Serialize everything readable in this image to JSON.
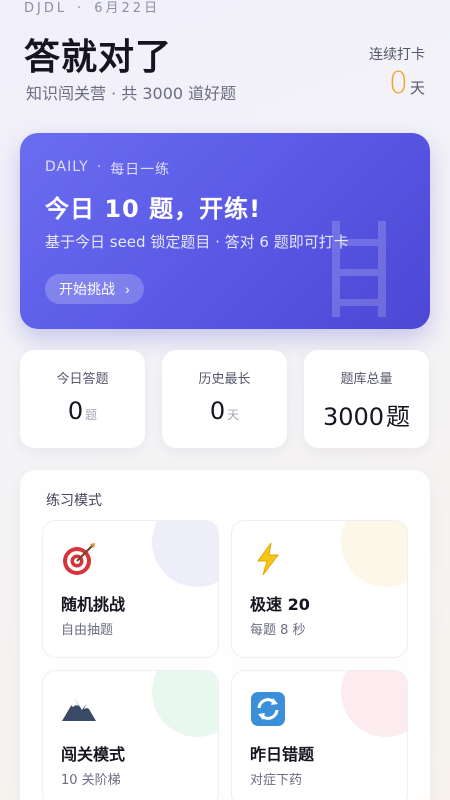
{
  "header": {
    "brand": "DJDL",
    "dot": "·",
    "date": "6月22日",
    "title": "答就对了",
    "subtitle": "知识闯关营 · 共 3000 道好题",
    "streak_label": "连续打卡",
    "streak_value": "0",
    "streak_unit": "天"
  },
  "daily": {
    "kicker_en": "DAILY",
    "kicker_sep": "·",
    "kicker_cn": "每日一练",
    "title": "今日 10 题，开练!",
    "desc": "基于今日 seed 锁定题目 · 答对 6 题即可打卡",
    "button": "开始挑战",
    "button_chevron": "›"
  },
  "stats": [
    {
      "label": "今日答题",
      "value": "0",
      "unit": "题"
    },
    {
      "label": "历史最长",
      "value": "0",
      "unit": "天"
    },
    {
      "label": "题库总量",
      "value": "3000",
      "unit": "题"
    }
  ],
  "practice": {
    "title": "练习模式",
    "modes": [
      {
        "name": "随机挑战",
        "desc": "自由抽题",
        "icon": "target-icon",
        "blob": "#eeeefb"
      },
      {
        "name": "极速 20",
        "desc": "每题 8 秒",
        "icon": "lightning-icon",
        "blob": "#fdf7e9"
      },
      {
        "name": "闯关模式",
        "desc": "10 关阶梯",
        "icon": "mountain-icon",
        "blob": "#e9f8ef"
      },
      {
        "name": "昨日错题",
        "desc": "对症下药",
        "icon": "repeat-icon",
        "blob": "#fdecef"
      }
    ]
  },
  "colors": {
    "accent": "#5a5ae6",
    "streak": "#f0a531",
    "text": "#15151f"
  }
}
